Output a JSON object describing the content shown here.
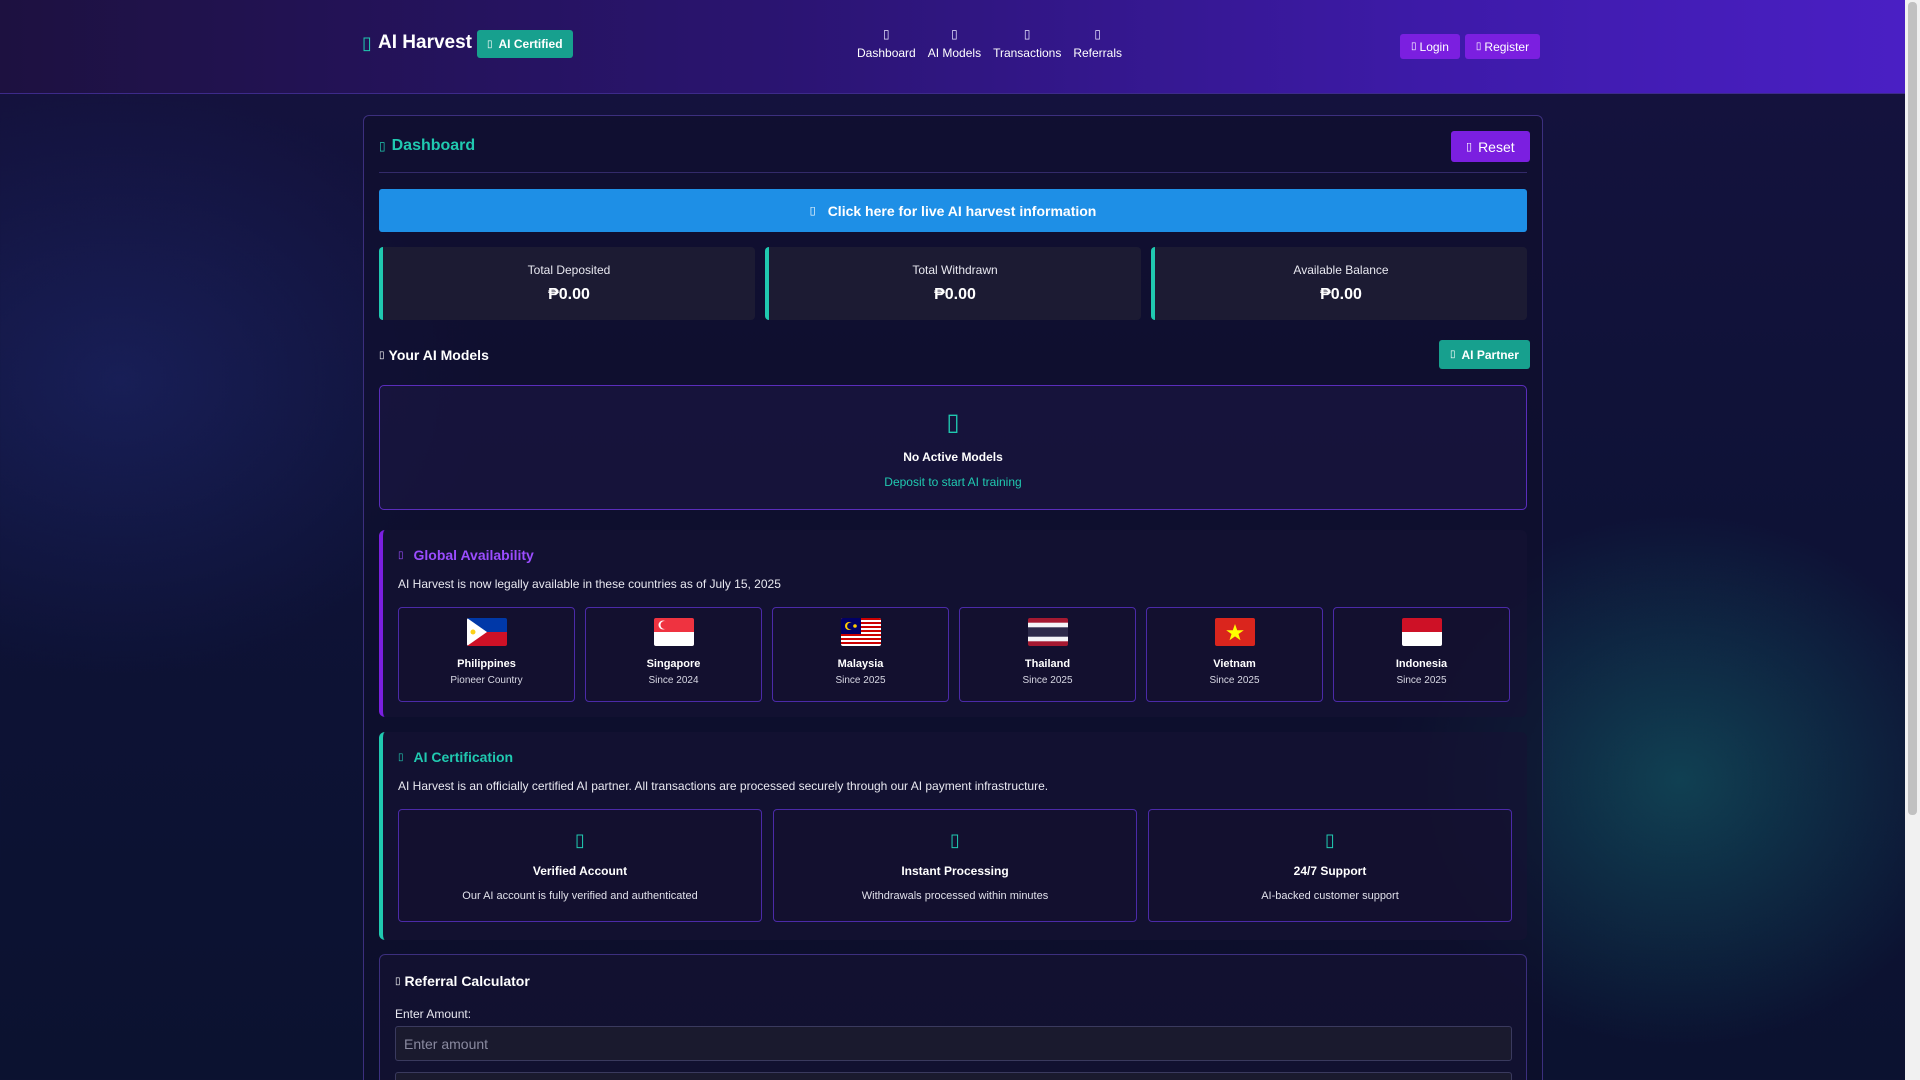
{
  "nav": {
    "brand": "AI Harvest",
    "brand_icon": "brain-icon",
    "certified_badge": "AI Certified",
    "links": [
      {
        "label": "Dashboard",
        "icon": "home-icon"
      },
      {
        "label": "AI Models",
        "icon": "robot-icon"
      },
      {
        "label": "Transactions",
        "icon": "exchange-icon"
      },
      {
        "label": "Referrals",
        "icon": "users-icon"
      }
    ],
    "login": "Login",
    "register": "Register"
  },
  "dashboard": {
    "title": "Dashboard",
    "reset_label": "Reset",
    "live_info_label": "Click here for live AI harvest information",
    "stats": [
      {
        "label": "Total Deposited",
        "value": "₱0.00"
      },
      {
        "label": "Total Withdrawn",
        "value": "₱0.00"
      },
      {
        "label": "Available Balance",
        "value": "₱0.00"
      }
    ]
  },
  "models": {
    "heading": "Your AI Models",
    "partner_label": "AI Partner",
    "empty_title": "No Active Models",
    "empty_sub": "Deposit to start AI training"
  },
  "availability": {
    "title": "Global Availability",
    "description": "AI Harvest is now legally available in these countries as of July 15, 2025",
    "countries": [
      {
        "name": "Philippines",
        "since": "Pioneer Country"
      },
      {
        "name": "Singapore",
        "since": "Since 2024"
      },
      {
        "name": "Malaysia",
        "since": "Since 2025"
      },
      {
        "name": "Thailand",
        "since": "Since 2025"
      },
      {
        "name": "Vietnam",
        "since": "Since 2025"
      },
      {
        "name": "Indonesia",
        "since": "Since 2025"
      }
    ]
  },
  "certification": {
    "title": "AI Certification",
    "description": "AI Harvest is an officially certified AI partner. All transactions are processed securely through our AI payment infrastructure.",
    "items": [
      {
        "title": "Verified Account",
        "desc": "Our AI account is fully verified and authenticated",
        "icon": "check-circle-icon"
      },
      {
        "title": "Instant Processing",
        "desc": "Withdrawals processed within minutes",
        "icon": "bolt-icon"
      },
      {
        "title": "24/7 Support",
        "desc": "AI-backed customer support",
        "icon": "headset-icon"
      }
    ]
  },
  "referral": {
    "title": "Referral Calculator",
    "amount_label": "Enter Amount:",
    "amount_placeholder": "Enter amount",
    "amount_value": ""
  },
  "colors": {
    "accent_teal": "#20c9b0",
    "accent_purple": "#7b1fe0",
    "info_blue": "#1e8fe6"
  }
}
